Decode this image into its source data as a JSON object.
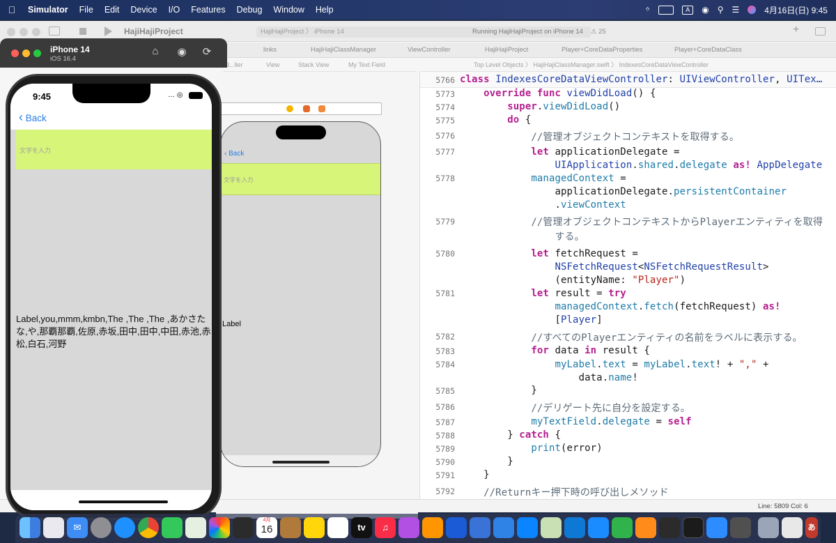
{
  "menubar": {
    "app": "Simulator",
    "items": [
      "File",
      "Edit",
      "Device",
      "I/O",
      "Features",
      "Debug",
      "Window",
      "Help"
    ],
    "input_mode": "A",
    "datetime": "4月16日(日) 9:45"
  },
  "xcode": {
    "project": "HajiHajiProject",
    "scheme_path": "HajiHajiProject 〉 iPhone 14",
    "run_status": "Running HajiHajiProject on iPhone 14",
    "warnings": "25",
    "tabs": [
      "links",
      "HajiHajiClassManager",
      "ViewController",
      "HajiHajiProject",
      "Player+CoreDataProperties",
      "Player+CoreDataClass"
    ],
    "jumpbar_left": [
      "d...ller",
      "View",
      "Stack View",
      "My Text Field"
    ],
    "jumpbar_right": "Top Level Objects 〉 HajiHajiClassManager.swift 〉 IndexesCoreDataViewController",
    "status_line": "Line: 5809  Col: 6"
  },
  "storyboard": {
    "back": "Back",
    "placeholder": "文字を入力",
    "label": "Label"
  },
  "code": {
    "sticky_line": "5766",
    "sticky_text": "class IndexesCoreDataViewController: UIViewController, UITex…",
    "lines": [
      {
        "n": "5773",
        "text": "    override func viewDidLoad() {"
      },
      {
        "n": "5774",
        "text": "        super.viewDidLoad()"
      },
      {
        "n": "5775",
        "text": "        do {"
      },
      {
        "n": "5776",
        "text": "            //管理オブジェクトコンテキストを取得する。"
      },
      {
        "n": "5777",
        "text": "            let applicationDelegate =\n                UIApplication.shared.delegate as! AppDelegate"
      },
      {
        "n": "5778",
        "text": "            managedContext =\n                applicationDelegate.persistentContainer\n                .viewContext"
      },
      {
        "n": "5779",
        "text": "            //管理オブジェクトコンテキストからPlayerエンティティを取得\n                する。"
      },
      {
        "n": "5780",
        "text": "            let fetchRequest =\n                NSFetchRequest<NSFetchRequestResult>\n                (entityName: \"Player\")"
      },
      {
        "n": "5781",
        "text": "            let result = try\n                managedContext.fetch(fetchRequest) as!\n                [Player]"
      },
      {
        "n": "5782",
        "text": "            //すべてのPlayerエンティティの名前をラベルに表示する。"
      },
      {
        "n": "5783",
        "text": "            for data in result {"
      },
      {
        "n": "5784",
        "text": "                myLabel.text = myLabel.text! + \",\" +\n                    data.name!"
      },
      {
        "n": "5785",
        "text": "            }"
      },
      {
        "n": "5786",
        "text": "            //デリゲート先に自分を設定する。"
      },
      {
        "n": "5787",
        "text": "            myTextField.delegate = self"
      },
      {
        "n": "5788",
        "text": "        } catch {"
      },
      {
        "n": "5789",
        "text": "            print(error)"
      },
      {
        "n": "5790",
        "text": "        }"
      },
      {
        "n": "5791",
        "text": "    }"
      },
      {
        "n": "5792",
        "text": "    //Returnキー押下時の呼び出しメソッド"
      }
    ]
  },
  "simulator": {
    "device": "iPhone 14",
    "os": "iOS 16.4",
    "time": "9:45",
    "back": "Back",
    "placeholder": "文字を入力",
    "label_text": "Label,you,mmm,kmbn,The ,The ,The ,あかさたな,や,那覇那覇,佐原,赤坂,田中,田中,中田,赤池,赤松,白石,河野"
  },
  "dock": {
    "calendar_month": "4月",
    "calendar_day": "16",
    "tv": "tv",
    "hiragana": "あ"
  },
  "colors": {
    "textfield_bg": "#d6f579",
    "link_blue": "#2a7de1",
    "keyword": "#b4208f"
  }
}
